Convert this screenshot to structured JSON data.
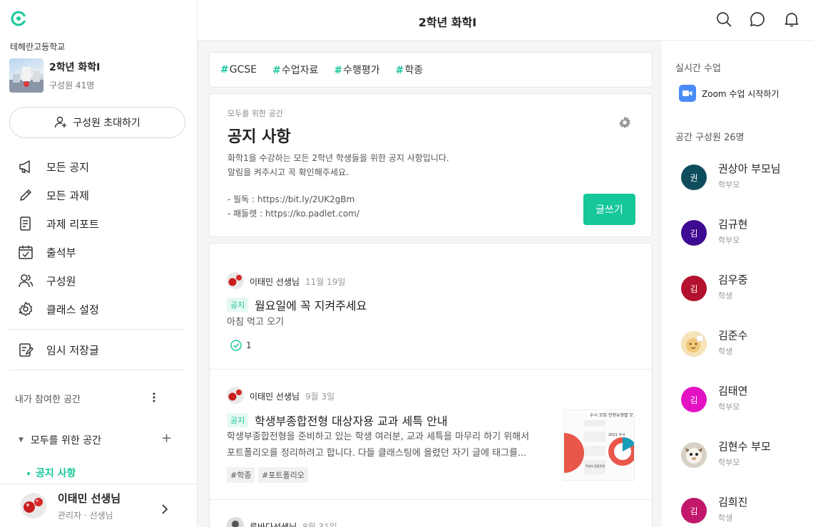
{
  "header": {
    "title": "2학년 화학I"
  },
  "sidebar": {
    "school": "테헤란고등학교",
    "class_name": "2학년 화학I",
    "class_members": "구성원 41명",
    "invite_label": "구성원 초대하기",
    "menu": [
      {
        "label": "모든 공지",
        "icon": "megaphone-icon"
      },
      {
        "label": "모든 과제",
        "icon": "pencil-icon"
      },
      {
        "label": "과제 리포트",
        "icon": "report-icon"
      },
      {
        "label": "출석부",
        "icon": "calendar-check-icon"
      },
      {
        "label": "구성원",
        "icon": "members-icon"
      },
      {
        "label": "클래스 설정",
        "icon": "gear-icon"
      }
    ],
    "drafts_label": "임시 저장글",
    "joined_title": "내가 참여한 공간",
    "space_group": "모두를 위한 공간",
    "space_active": "공지 사항",
    "user": {
      "name": "이태민 선생님",
      "role": "관리자 · 선생님"
    }
  },
  "tags": [
    "GCSE",
    "수업자료",
    "수행평가",
    "학종"
  ],
  "notice": {
    "subtitle": "모두를 위한 공간",
    "title": "공지 사항",
    "desc_line1": "화학1을 수강하는 모든 2학년 학생들을 위한 공지 사항입니다.",
    "desc_line2": "알림을 켜주시고 꼭 확인해주세요.",
    "link_line1": "- 필독 : https://bit.ly/2UK2gBm",
    "link_line2": "- 패들렛 : https://ko.padlet.com/",
    "write_label": "글쓰기"
  },
  "posts": [
    {
      "author": "이태민 선생님",
      "date": "11월 19일",
      "badge": "공지",
      "title": "월요일에 꼭 지켜주세요",
      "body": "아침 먹고 오기",
      "check_count": "1"
    },
    {
      "author": "이태민 선생님",
      "date": "9월 3일",
      "badge": "공지",
      "title": "학생부종합전형 대상자용 교과 세특 안내",
      "body1": "학생부종합전형을 준비하고 있는 학생 여러분, 교과 세특을 마무리 하기 위해서",
      "body2": "포트폴리오를 정리하려고 합니다. 다들 클래스팅에 올렸던 자기 글에 태그를...",
      "tags": [
        "#학종",
        "#포트폴리오"
      ],
      "thumb_texts": [
        "수시 모집 전형유형별 모",
        "2021 수시",
        "학생부 종합전형"
      ]
    },
    {
      "author": "류바다선생님",
      "date": "8월 31일"
    }
  ],
  "right": {
    "live_title": "실시간 수업",
    "zoom_label": "Zoom 수업 시작하기",
    "members_title": "공간 구성원 26명",
    "members": [
      {
        "initial": "권",
        "name": "권상아 부모님",
        "role": "학부모",
        "color": "#0f4c5c"
      },
      {
        "initial": "김",
        "name": "김규현",
        "role": "학부모",
        "color": "#3d0a91"
      },
      {
        "initial": "김",
        "name": "김우중",
        "role": "학생",
        "color": "#b3122e"
      },
      {
        "initial": "",
        "name": "김준수",
        "role": "학생",
        "color": "#f3d9a4"
      },
      {
        "initial": "김",
        "name": "김태연",
        "role": "학부모",
        "color": "#e313c4"
      },
      {
        "initial": "",
        "name": "김현수 부모",
        "role": "학부모",
        "color": "#e9e4dc"
      },
      {
        "initial": "김",
        "name": "김희진",
        "role": "학생",
        "color": "#c2186b"
      }
    ]
  }
}
